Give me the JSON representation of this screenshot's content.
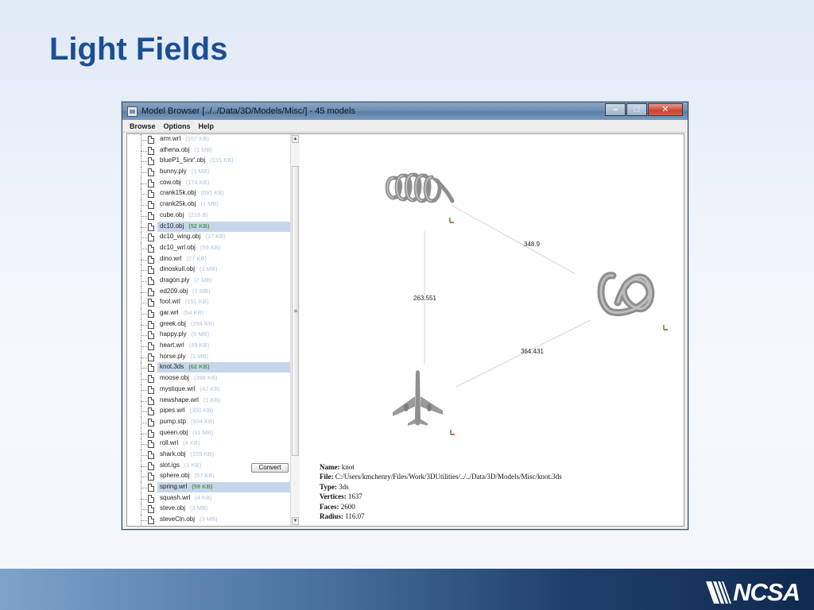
{
  "slide": {
    "title": "Light Fields"
  },
  "window": {
    "title": "Model Browser [../../Data/3D/Models/Misc/] - 45 models",
    "controls": [
      "minimize",
      "maximize",
      "close"
    ]
  },
  "menu": [
    {
      "id": "browse",
      "label": "Browse"
    },
    {
      "id": "options",
      "label": "Options"
    },
    {
      "id": "help",
      "label": "Help"
    }
  ],
  "files": [
    {
      "name": "arm.wrl",
      "size": "(157 KB)",
      "selected": false
    },
    {
      "name": "athena.obj",
      "size": "(1 MB)",
      "selected": false
    },
    {
      "name": "blueP1_5inr'.obj",
      "size": "(131 KB)",
      "selected": false
    },
    {
      "name": "bunny.ply",
      "size": "(1 MB)",
      "selected": false
    },
    {
      "name": "cow.obj",
      "size": "(174 KB)",
      "selected": false
    },
    {
      "name": "crank15k.obj",
      "size": "(691 KB)",
      "selected": false
    },
    {
      "name": "crank25k.obj",
      "size": "(1 MB)",
      "selected": false
    },
    {
      "name": "cube.obj",
      "size": "(216 B)",
      "selected": false
    },
    {
      "name": "dc10.obj",
      "size": "(52 KB)",
      "selected": true
    },
    {
      "name": "dc10_wing.obj",
      "size": "(37 KB)",
      "selected": false
    },
    {
      "name": "dc10_wrl.obj",
      "size": "(59 KB)",
      "selected": false
    },
    {
      "name": "dino.wrl",
      "size": "(27 KB)",
      "selected": false
    },
    {
      "name": "dinoskull.obj",
      "size": "(1 MB)",
      "selected": false
    },
    {
      "name": "dragon.ply",
      "size": "(7 MB)",
      "selected": false
    },
    {
      "name": "ed209.obj",
      "size": "(1 MB)",
      "selected": false
    },
    {
      "name": "foot.wrl",
      "size": "(151 KB)",
      "selected": false
    },
    {
      "name": "gar.wrl",
      "size": "(54 KB)",
      "selected": false
    },
    {
      "name": "greek.obj",
      "size": "(294 KB)",
      "selected": false
    },
    {
      "name": "happy.ply",
      "size": "(9 MB)",
      "selected": false
    },
    {
      "name": "heart.wrl",
      "size": "(49 KB)",
      "selected": false
    },
    {
      "name": "horse.ply",
      "size": "(1 MB)",
      "selected": false
    },
    {
      "name": "knot.3ds",
      "size": "(62 KB)",
      "selected": true
    },
    {
      "name": "moose.obj",
      "size": "(398 KB)",
      "selected": false
    },
    {
      "name": "mystique.wrl",
      "size": "(42 KB)",
      "selected": false
    },
    {
      "name": "newshape.wrl",
      "size": "(1 KB)",
      "selected": false
    },
    {
      "name": "pipes.wrl",
      "size": "(300 KB)",
      "selected": false
    },
    {
      "name": "pump.stp",
      "size": "(604 KB)",
      "selected": false
    },
    {
      "name": "queen.obj",
      "size": "(11 MB)",
      "selected": false
    },
    {
      "name": "roll.wrl",
      "size": "(4 KB)",
      "selected": false
    },
    {
      "name": "shark.obj",
      "size": "(155 KB)",
      "selected": false
    },
    {
      "name": "slot.igs",
      "size": "(1 KB)",
      "selected": false
    },
    {
      "name": "sphere.obj",
      "size": "(57 KB)",
      "selected": false
    },
    {
      "name": "spring.wrl",
      "size": "(59 KB)",
      "selected": true
    },
    {
      "name": "squash.wrl",
      "size": "(4 KB)",
      "selected": false
    },
    {
      "name": "steve.obj",
      "size": "(3 MB)",
      "selected": false
    },
    {
      "name": "steveCln.obj",
      "size": "(3 MB)",
      "selected": false
    }
  ],
  "convert_label": "Convert",
  "graph": {
    "edges": [
      {
        "from": "spring",
        "to": "knot",
        "label": "348.9"
      },
      {
        "from": "spring",
        "to": "plane",
        "label": "263.551"
      },
      {
        "from": "knot",
        "to": "plane",
        "label": "364.431"
      }
    ]
  },
  "info": {
    "name_label": "Name:",
    "name": "knot",
    "file_label": "File:",
    "file": "C:/Users/kmchenry/Files/Work/3DUtilities/../../Data/3D/Models/Misc/knot.3ds",
    "type_label": "Type:",
    "type": "3ds",
    "vertices_label": "Vertices:",
    "vertices": "1637",
    "faces_label": "Faces:",
    "faces": "2600",
    "radius_label": "Radius:",
    "radius": "116.07"
  },
  "logo": {
    "text": "NCSA"
  },
  "colors": {
    "title": "#1c4e96",
    "selection": "#c6d6ea",
    "selected_size": "#4f9a4f",
    "size_text": "#aec4dd"
  }
}
